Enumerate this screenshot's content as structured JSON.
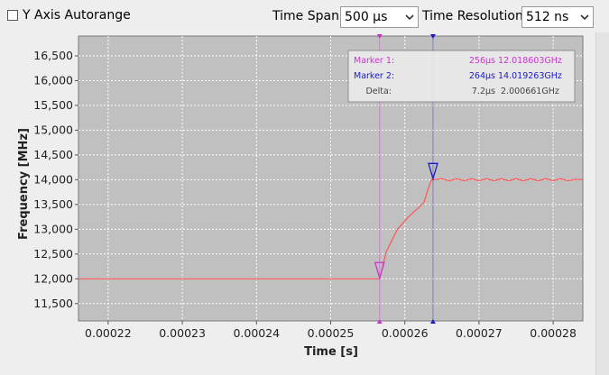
{
  "toolbar": {
    "autorange_label": "Y Axis Autorange",
    "autorange_checked": false,
    "time_span_label": "Time Span",
    "time_span_value": "500 µs",
    "time_resolution_label": "Time Resolution",
    "time_resolution_value": "512 ns"
  },
  "markers": {
    "marker1": {
      "label": "Marker 1:",
      "time": "256µs",
      "freq": "12.018603GHz",
      "color": "#cc33cc"
    },
    "marker2": {
      "label": "Marker 2:",
      "time": "264µs",
      "freq": "14.019263GHz",
      "color": "#1a1acc"
    },
    "delta": {
      "label": "Delta:",
      "time": "7.2µs",
      "freq": "2.000661GHz",
      "color": "#444444"
    }
  },
  "colors": {
    "plot_bg": "#c0c0c0",
    "trace": "#ff5555",
    "grid": "#ffffff"
  },
  "chart_data": {
    "type": "line",
    "xlabel": "Time [s]",
    "ylabel": "Frequency [MHz]",
    "xlim": [
      0.000216,
      0.000284
    ],
    "ylim": [
      11150,
      16900
    ],
    "x_ticks": [
      0.00022,
      0.00023,
      0.00024,
      0.00025,
      0.00026,
      0.00027,
      0.00028
    ],
    "x_tick_labels": [
      "0.00022",
      "0.00023",
      "0.00024",
      "0.00025",
      "0.00026",
      "0.00027",
      "0.00028"
    ],
    "y_ticks": [
      11500,
      12000,
      12500,
      13000,
      13500,
      14000,
      14500,
      15000,
      15500,
      16000,
      16500
    ],
    "y_tick_labels": [
      "11,500",
      "12,000",
      "12,500",
      "13,000",
      "13,500",
      "14,000",
      "14,500",
      "15,000",
      "15,500",
      "16,000",
      "16,500"
    ],
    "grid": true,
    "marker_x": [
      0.0002566,
      0.0002638
    ],
    "series": [
      {
        "values_x": [
          0.000216,
          0.0002566,
          0.0002575,
          0.000259,
          0.0002605,
          0.0002612,
          0.000262,
          0.0002626,
          0.0002631,
          0.0002636,
          0.0002639,
          0.000265,
          0.000266,
          0.000267,
          0.000268,
          0.000269,
          0.00027,
          0.000271,
          0.000272,
          0.000273,
          0.000274,
          0.000275,
          0.000276,
          0.000277,
          0.000278,
          0.000279,
          0.00028,
          0.000281,
          0.000282,
          0.000283,
          0.000284
        ],
        "values_y": [
          12000,
          12000,
          12550,
          13000,
          13250,
          13350,
          13450,
          13550,
          13800,
          14000,
          14000,
          14020,
          13980,
          14020,
          13980,
          14020,
          13980,
          14020,
          13980,
          14020,
          13980,
          14020,
          13980,
          14020,
          13980,
          14020,
          13980,
          14020,
          13980,
          14010,
          14000
        ]
      }
    ]
  }
}
